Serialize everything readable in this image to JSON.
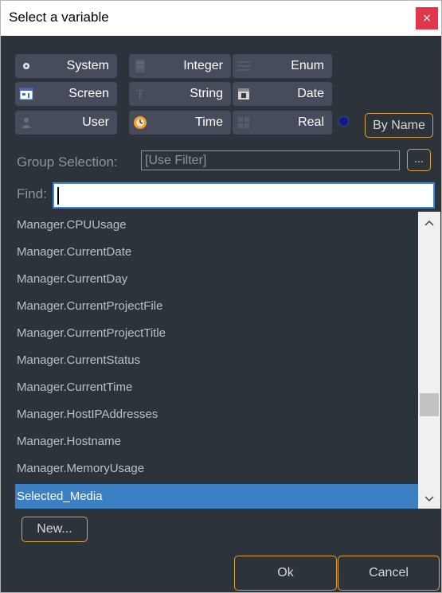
{
  "window": {
    "title": "Select a variable",
    "close_glyph": "×"
  },
  "types": [
    {
      "label": "System",
      "icon": "system-icon"
    },
    {
      "label": "Integer",
      "icon": "integer-icon"
    },
    {
      "label": "Enum",
      "icon": "enum-icon"
    },
    {
      "label": "Screen",
      "icon": "screen-icon"
    },
    {
      "label": "String",
      "icon": "string-icon"
    },
    {
      "label": "Date",
      "icon": "date-icon"
    },
    {
      "label": "User",
      "icon": "user-icon"
    },
    {
      "label": "Time",
      "icon": "time-icon"
    },
    {
      "label": "Real",
      "icon": "real-icon"
    }
  ],
  "sort": {
    "by_name_label": "By Name"
  },
  "group": {
    "label": "Group Selection:",
    "value": "[Use Filter]",
    "browse_label": "..."
  },
  "find": {
    "label": "Find:",
    "value": ""
  },
  "list": {
    "items": [
      "Manager.CPUUsage",
      "Manager.CurrentDate",
      "Manager.CurrentDay",
      "Manager.CurrentProjectFile",
      "Manager.CurrentProjectTitle",
      "Manager.CurrentStatus",
      "Manager.CurrentTime",
      "Manager.HostIPAddresses",
      "Manager.Hostname",
      "Manager.MemoryUsage",
      "Selected_Media"
    ],
    "selected": "Selected_Media"
  },
  "buttons": {
    "new_label": "New...",
    "ok_label": "Ok",
    "cancel_label": "Cancel"
  },
  "colors": {
    "background": "#2d333b",
    "button": "#464c5b",
    "accent_border": "#e0a23a",
    "selection": "#3c7fc2",
    "close": "#e0374b"
  }
}
